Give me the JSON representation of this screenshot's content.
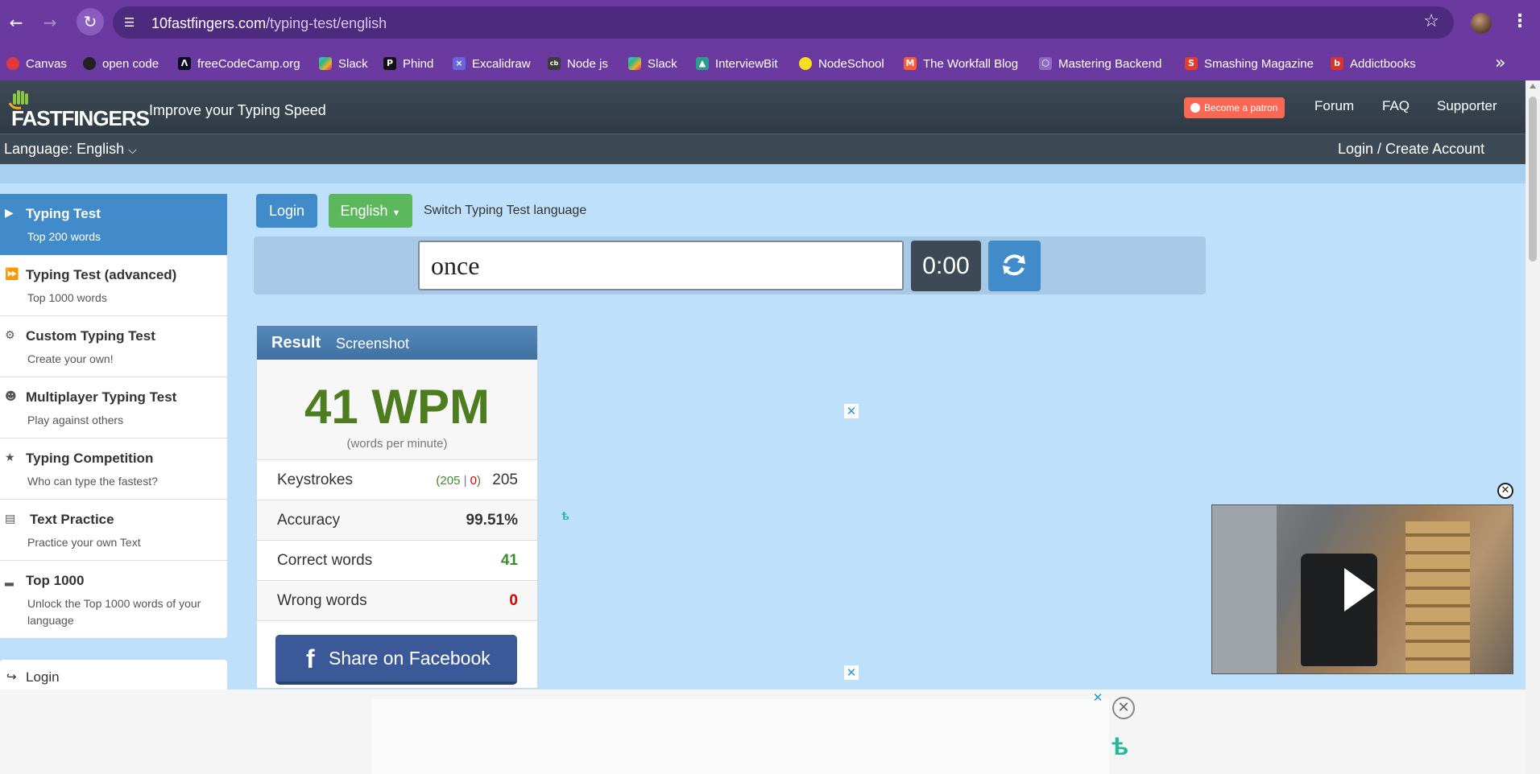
{
  "browser": {
    "url_domain": "10fastfingers.com",
    "url_path": "/typing-test/english",
    "bookmarks": [
      {
        "label": "Canvas",
        "color": "#e03a3e"
      },
      {
        "label": "open code",
        "color": "#222222"
      },
      {
        "label": "freeCodeCamp.org",
        "color": "#0a0a23"
      },
      {
        "label": "Slack",
        "color": "#4a154b"
      },
      {
        "label": "Phind",
        "color": "#111111"
      },
      {
        "label": "Excalidraw",
        "color": "#6965db"
      },
      {
        "label": "Node js",
        "color": "#333333"
      },
      {
        "label": "Slack",
        "color": "#4a154b"
      },
      {
        "label": "InterviewBit",
        "color": "#2a9d8f"
      },
      {
        "label": "NodeSchool",
        "color": "#f7df1e"
      },
      {
        "label": "The Workfall Blog",
        "color": "#ff5a36"
      },
      {
        "label": "Mastering Backend",
        "color": "#6b3aa0"
      },
      {
        "label": "Smashing Magazine",
        "color": "#e53b2c"
      },
      {
        "label": "Addictbooks",
        "color": "#d9342b"
      }
    ]
  },
  "header": {
    "logo": "FASTFINGERS",
    "tagline": "Improve your Typing Speed",
    "patron": "Become a patron",
    "nav": [
      "Forum",
      "FAQ",
      "Supporter"
    ],
    "language": "Language: English",
    "login_create": "Login / Create Account"
  },
  "sidebar": {
    "items": [
      {
        "title": "Typing Test",
        "sub": "Top 200 words",
        "icon": "play-icon"
      },
      {
        "title": "Typing Test (advanced)",
        "sub": "Top 1000 words",
        "icon": "fast-forward-icon"
      },
      {
        "title": "Custom Typing Test",
        "sub": "Create your own!",
        "icon": "gears-icon"
      },
      {
        "title": "Multiplayer Typing Test",
        "sub": "Play against others",
        "icon": "users-icon"
      },
      {
        "title": "Typing Competition",
        "sub": "Who can type the fastest?",
        "icon": "trophy-icon"
      },
      {
        "title": "Text Practice",
        "sub": "Practice your own Text",
        "icon": "document-icon"
      },
      {
        "title": "Top 1000",
        "sub": "Unlock the Top 1000 words of your language",
        "icon": "signal-icon"
      }
    ],
    "login": "Login"
  },
  "toolbar": {
    "login": "Login",
    "language": "English",
    "switch_text": "Switch Typing Test language"
  },
  "test": {
    "current_word": "once",
    "timer": "0:00"
  },
  "result": {
    "title": "Result",
    "screenshot": "Screenshot",
    "wpm": "41 WPM",
    "wpm_sub": "(words per minute)",
    "keystrokes_label": "Keystrokes",
    "keystrokes_correct": "205",
    "keystrokes_wrong": "0",
    "keystrokes_total": "205",
    "accuracy_label": "Accuracy",
    "accuracy": "99.51%",
    "correct_label": "Correct words",
    "correct": "41",
    "wrong_label": "Wrong words",
    "wrong": "0",
    "facebook": "Share on Facebook"
  },
  "colors": {
    "accent": "#428bca",
    "success": "#5cb85c",
    "wpm": "#4d7d1f",
    "chrome": "#6b3aa0"
  }
}
